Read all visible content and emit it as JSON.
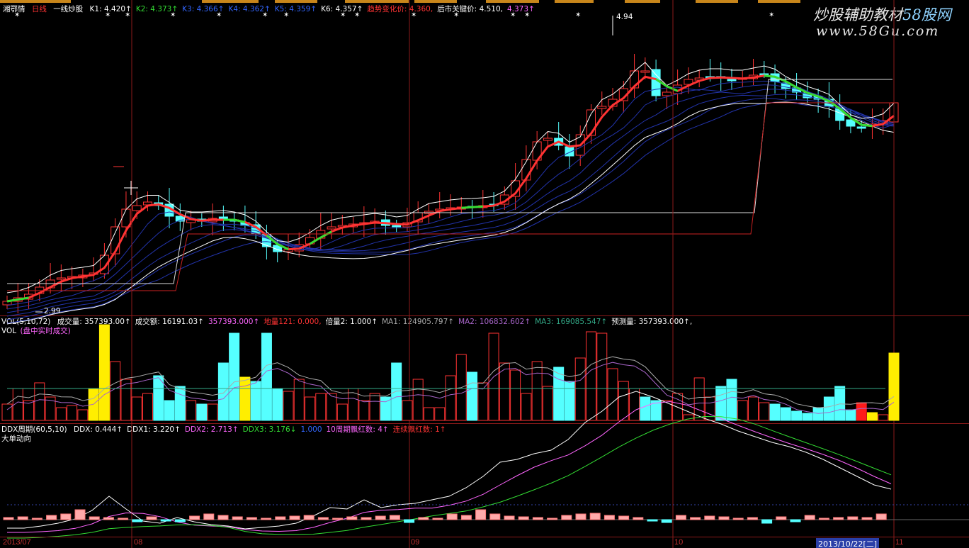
{
  "stock": {
    "name": "湘鄂情",
    "period": "日线",
    "indicator_name": "一线炒股"
  },
  "main_indicators": [
    {
      "label": "K1: 4.420",
      "arrow": "↑",
      "color": "#ffffff"
    },
    {
      "label": "K2: 4.373",
      "arrow": "↑",
      "color": "#33dd33"
    },
    {
      "label": "K3: 4.366",
      "arrow": "↑",
      "color": "#3366ff"
    },
    {
      "label": "K4: 4.362",
      "arrow": "↑",
      "color": "#3366ff"
    },
    {
      "label": "K5: 4.359",
      "arrow": "↑",
      "color": "#3366ff"
    },
    {
      "label": "K6: 4.357",
      "arrow": "↑",
      "color": "#ffffff"
    },
    {
      "label": "趋势变化价: 4.360,",
      "arrow": "",
      "color": "#ff3333"
    },
    {
      "label": "后市关键价: 4.510,",
      "arrow": "",
      "color": "#ffffff"
    },
    {
      "label": "4.373",
      "arrow": "↑",
      "color": "#ff66ff"
    }
  ],
  "price_marks": {
    "high": "4.94",
    "low": "2.99"
  },
  "vol_panel": {
    "title": "VOL(5,10,72)",
    "subtitle": "VOL",
    "subtitle_note": "(盘中实时成交)",
    "fields": [
      {
        "label": "成交量: 357393.00",
        "arrow": "↑",
        "color": "#ffffff"
      },
      {
        "label": "成交额: 16191.03",
        "arrow": "↑",
        "color": "#ffffff"
      },
      {
        "label": "357393.000",
        "arrow": "↑",
        "color": "#ff66ff"
      },
      {
        "label": "地量121: 0.000,",
        "arrow": "",
        "color": "#ff3333"
      },
      {
        "label": "倍量2: 1.000",
        "arrow": "↑",
        "color": "#ffffff"
      },
      {
        "label": "MA1: 124905.797",
        "arrow": "↑",
        "color": "#aaaaaa"
      },
      {
        "label": "MA2: 106832.602",
        "arrow": "↑",
        "color": "#aa66cc"
      },
      {
        "label": "MA3: 169085.547",
        "arrow": "↑",
        "color": "#33aa88"
      },
      {
        "label": "预测量: 357393.000",
        "arrow": "↑,",
        "color": "#ffffff"
      }
    ]
  },
  "ddx_panel": {
    "title": "DDX周期(60,5,10)",
    "subtitle": "大单动向",
    "fields": [
      {
        "label": "DDX: 0.444",
        "arrow": "↑",
        "color": "#ffffff"
      },
      {
        "label": "DDX1: 3.220",
        "arrow": "↑",
        "color": "#ffffff"
      },
      {
        "label": "DDX2: 2.713",
        "arrow": "↑",
        "color": "#ff66ff"
      },
      {
        "label": "DDX3: 3.176",
        "arrow": "↓",
        "color": "#33dd33"
      },
      {
        "label": "1.000",
        "arrow": "",
        "color": "#3366ff"
      },
      {
        "label": "10周期飘红数: 4",
        "arrow": "↑",
        "color": "#ff66ff"
      },
      {
        "label": "连续飘红数: 1",
        "arrow": "↑",
        "color": "#ff3333"
      }
    ]
  },
  "x_axis": {
    "labels": [
      "2013/07",
      "08",
      "09",
      "10",
      "11"
    ],
    "highlight": "2013/10/22[二]"
  },
  "watermark": {
    "line1_a": "炒股辅助教材",
    "line1_b": "58股网",
    "line2": "www.58Gu.com"
  },
  "colors": {
    "up": "#ff3333",
    "down": "#55ffff",
    "yellow": "#ffee00",
    "frame": "#8b1a1a"
  }
}
